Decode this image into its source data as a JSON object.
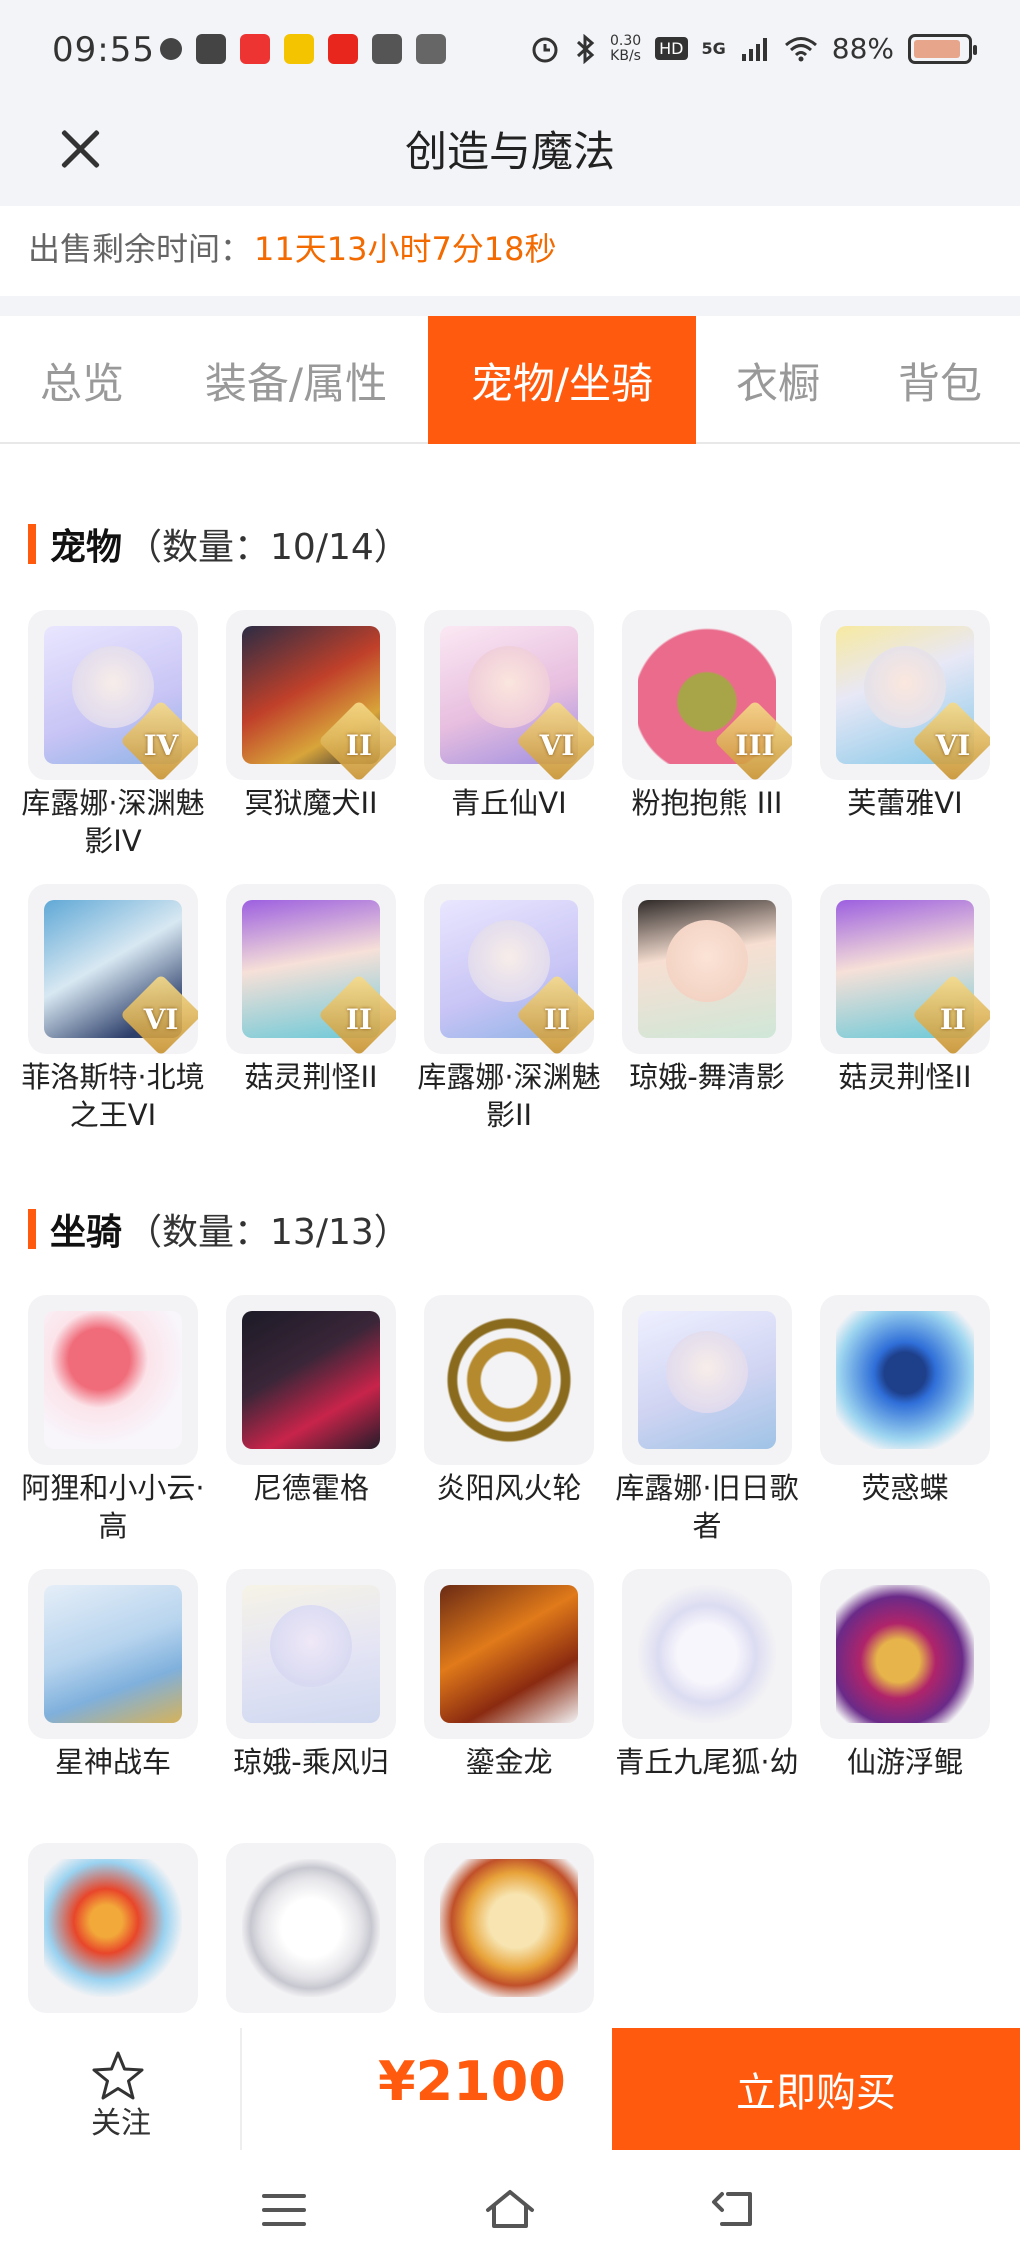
{
  "status_bar": {
    "time": "09:55",
    "net_speed_value": "0.30",
    "net_speed_unit": "KB/s",
    "hd": "HD",
    "signal": "5G",
    "battery": "88%",
    "battery_level": 0.88
  },
  "header": {
    "title": "创造与魔法"
  },
  "timer": {
    "label": "出售剩余时间：",
    "value": "11天13小时7分18秒"
  },
  "tabs": [
    {
      "label": "总览",
      "active": false
    },
    {
      "label": "装备/属性",
      "active": false
    },
    {
      "label": "宠物/坐骑",
      "active": true
    },
    {
      "label": "衣橱",
      "active": false
    },
    {
      "label": "背包",
      "active": false
    }
  ],
  "pets": {
    "title": "宠物",
    "count": "（数量：10/14）",
    "items": [
      {
        "name": "库露娜·深渊魅影IV",
        "badge": "IV"
      },
      {
        "name": "冥狱魔犬II",
        "badge": "II"
      },
      {
        "name": "青丘仙VI",
        "badge": "VI"
      },
      {
        "name": "粉抱抱熊 III",
        "badge": "III"
      },
      {
        "name": "芙蕾雅VI",
        "badge": "VI"
      },
      {
        "name": "菲洛斯特·北境之王VI",
        "badge": "VI"
      },
      {
        "name": "菇灵荆怪II",
        "badge": "II"
      },
      {
        "name": "库露娜·深渊魅影II",
        "badge": "II"
      },
      {
        "name": "琼娥-舞清影",
        "badge": ""
      },
      {
        "name": "菇灵荆怪II",
        "badge": "II"
      }
    ]
  },
  "mounts": {
    "title": "坐骑",
    "count": "（数量：13/13）",
    "items": [
      {
        "name": "阿狸和小小云·高"
      },
      {
        "name": "尼德霍格"
      },
      {
        "name": "炎阳风火轮"
      },
      {
        "name": "库露娜·旧日歌者"
      },
      {
        "name": "荧惑蝶"
      },
      {
        "name": "星神战车"
      },
      {
        "name": "琼娥-乘风归"
      },
      {
        "name": "鎏金龙"
      },
      {
        "name": "青丘九尾狐·幼"
      },
      {
        "name": "仙游浮鲲"
      },
      {
        "name": ""
      },
      {
        "name": ""
      },
      {
        "name": ""
      }
    ]
  },
  "bottom": {
    "follow_label": "关注",
    "price": "¥2100",
    "buy_label": "立即购买"
  },
  "colors": {
    "accent": "#ff5a0d",
    "timer": "#f26a00"
  }
}
